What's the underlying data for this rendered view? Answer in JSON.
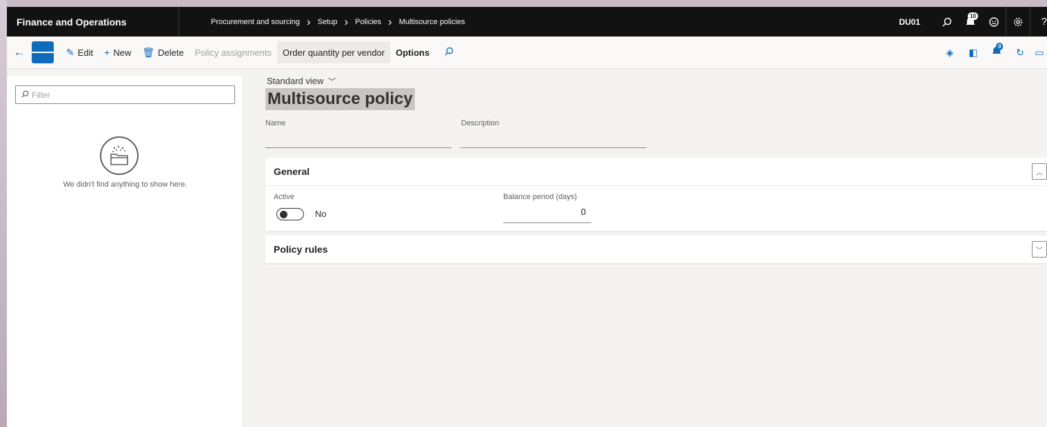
{
  "topbar": {
    "app_name": "Finance and Operations",
    "breadcrumb": [
      "Procurement and sourcing",
      "Setup",
      "Policies",
      "Multisource policies"
    ],
    "company": "DU01",
    "notifications_badge": "10",
    "icons": [
      "search-icon",
      "notifications-icon",
      "smiley-icon",
      "gear-icon",
      "help-icon"
    ],
    "help_glyph": "?"
  },
  "actions": {
    "edit": "Edit",
    "new": "New",
    "delete": "Delete",
    "policy_assignments": "Policy assignments",
    "order_quantity": "Order quantity per vendor",
    "options": "Options",
    "attachments_badge": "0"
  },
  "list": {
    "filter_placeholder": "Filter",
    "empty_message": "We didn't find anything to show here."
  },
  "form": {
    "view_name": "Standard view",
    "title": "Multisource policy",
    "name_label": "Name",
    "name_value": "",
    "description_label": "Description",
    "description_value": "",
    "general": {
      "header": "General",
      "active_label": "Active",
      "active_value": "No",
      "balance_label": "Balance period (days)",
      "balance_value": "0"
    },
    "policy_rules": {
      "header": "Policy rules"
    }
  },
  "colors": {
    "accent": "#0f6cbd",
    "topbar": "#121212"
  }
}
